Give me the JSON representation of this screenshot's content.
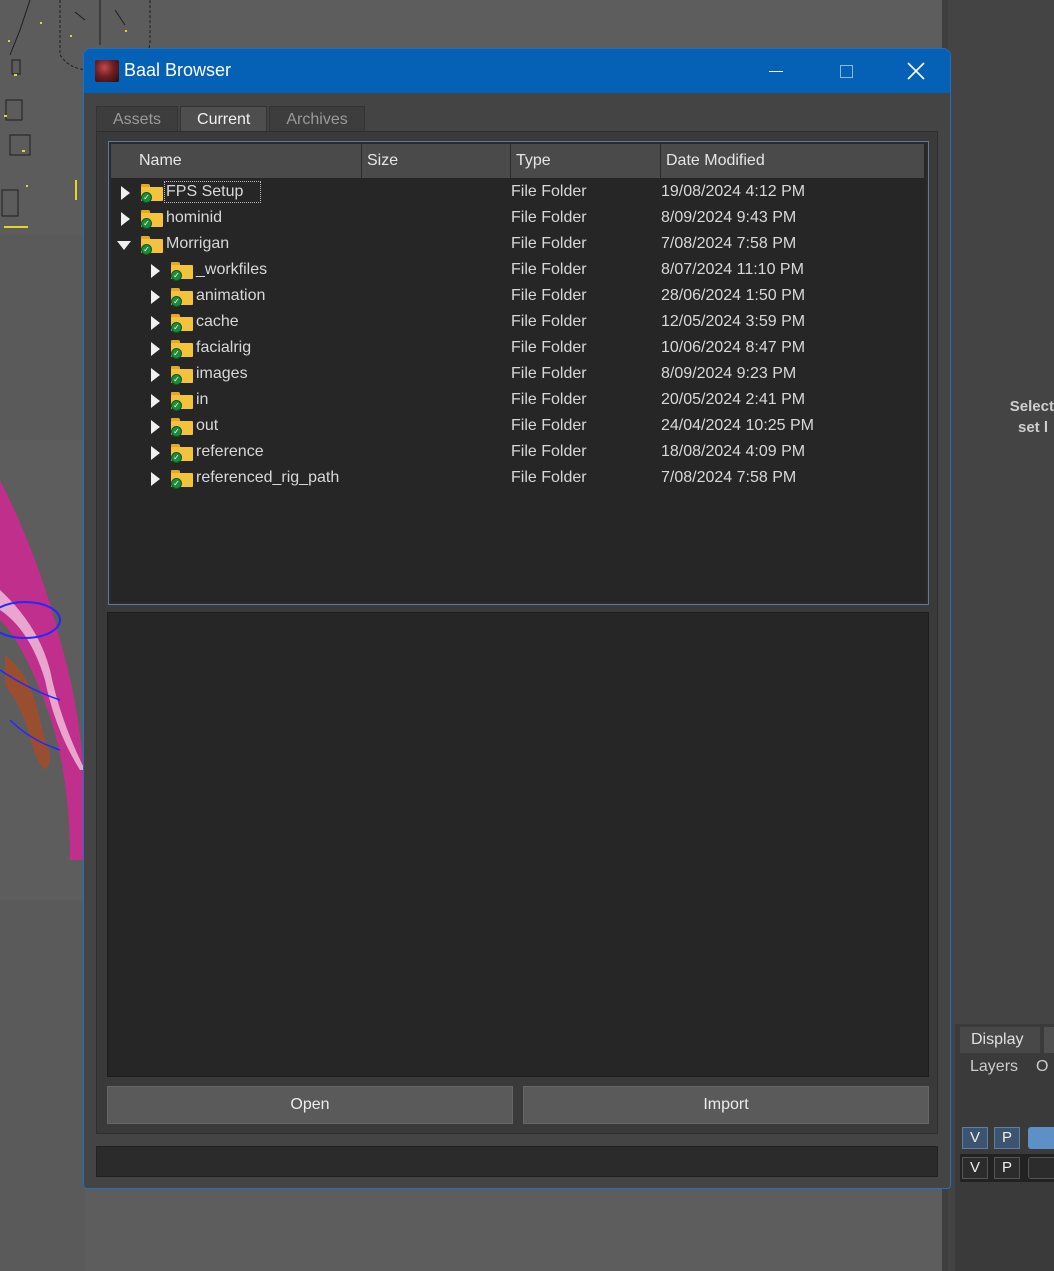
{
  "background": {
    "right_panel_text": [
      "Select",
      "set l"
    ],
    "layer_tabs": [
      "Display"
    ],
    "layer_menu": [
      "Layers",
      "O"
    ],
    "layer_rows": [
      {
        "v": "V",
        "p": "P"
      },
      {
        "v": "V",
        "p": "P"
      }
    ]
  },
  "window": {
    "title": "Baal Browser",
    "icon": "baal-dragon-icon",
    "controls": {
      "minimize": "minimize-icon",
      "maximize": "maximize-icon",
      "close": "close-icon"
    }
  },
  "tabs": [
    {
      "label": "Assets",
      "active": false
    },
    {
      "label": "Current",
      "active": true
    },
    {
      "label": "Archives",
      "active": false
    }
  ],
  "tree": {
    "columns": {
      "name": "Name",
      "size": "Size",
      "type": "Type",
      "date": "Date Modified"
    },
    "rows": [
      {
        "name": "FPS Setup",
        "type": "File Folder",
        "date": "19/08/2024 4:12 PM",
        "level": 0,
        "expanded": false,
        "focused": true
      },
      {
        "name": "hominid",
        "type": "File Folder",
        "date": "8/09/2024 9:43 PM",
        "level": 0,
        "expanded": false
      },
      {
        "name": "Morrigan",
        "type": "File Folder",
        "date": "7/08/2024 7:58 PM",
        "level": 0,
        "expanded": true
      },
      {
        "name": "_workfiles",
        "type": "File Folder",
        "date": "8/07/2024 11:10 PM",
        "level": 1,
        "expanded": false
      },
      {
        "name": "animation",
        "type": "File Folder",
        "date": "28/06/2024 1:50 PM",
        "level": 1,
        "expanded": false
      },
      {
        "name": "cache",
        "type": "File Folder",
        "date": "12/05/2024 3:59 PM",
        "level": 1,
        "expanded": false
      },
      {
        "name": "facialrig",
        "type": "File Folder",
        "date": "10/06/2024 8:47 PM",
        "level": 1,
        "expanded": false
      },
      {
        "name": "images",
        "type": "File Folder",
        "date": "8/09/2024 9:23 PM",
        "level": 1,
        "expanded": false
      },
      {
        "name": "in",
        "type": "File Folder",
        "date": "20/05/2024 2:41 PM",
        "level": 1,
        "expanded": false
      },
      {
        "name": "out",
        "type": "File Folder",
        "date": "24/04/2024 10:25 PM",
        "level": 1,
        "expanded": false
      },
      {
        "name": "reference",
        "type": "File Folder",
        "date": "18/08/2024 4:09 PM",
        "level": 1,
        "expanded": false
      },
      {
        "name": "referenced_rig_path",
        "type": "File Folder",
        "date": "7/08/2024 7:58 PM",
        "level": 1,
        "expanded": false
      }
    ]
  },
  "buttons": {
    "open": "Open",
    "import": "Import"
  },
  "status": ""
}
